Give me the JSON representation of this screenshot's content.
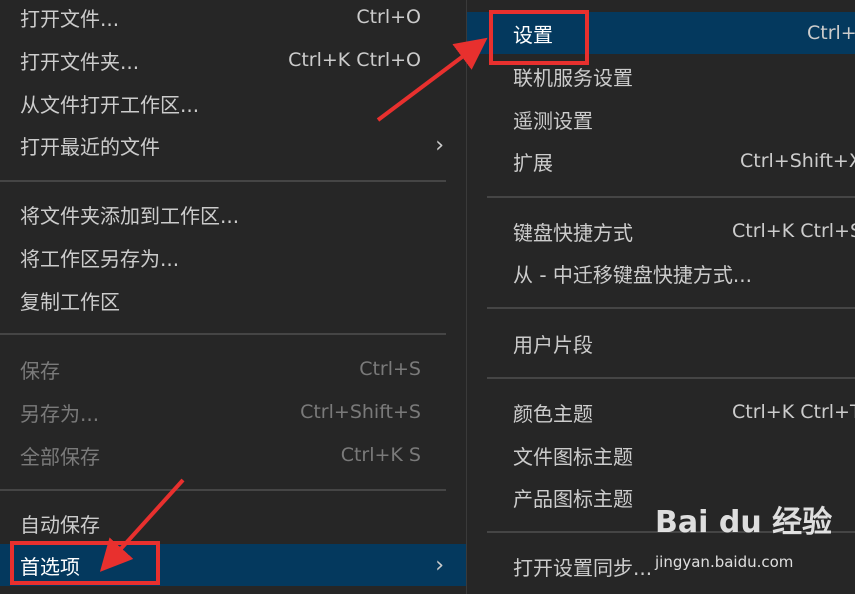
{
  "file_menu": {
    "items": [
      {
        "label": "打开文件...",
        "shortcut": "Ctrl+O"
      },
      {
        "label": "打开文件夹...",
        "shortcut": "Ctrl+K Ctrl+O"
      },
      {
        "label": "从文件打开工作区...",
        "shortcut": ""
      },
      {
        "label": "打开最近的文件",
        "shortcut": "",
        "submenu": true
      },
      {
        "label": "将文件夹添加到工作区...",
        "shortcut": ""
      },
      {
        "label": "将工作区另存为...",
        "shortcut": ""
      },
      {
        "label": "复制工作区",
        "shortcut": ""
      },
      {
        "label": "保存",
        "shortcut": "Ctrl+S",
        "disabled": true
      },
      {
        "label": "另存为...",
        "shortcut": "Ctrl+Shift+S",
        "disabled": true
      },
      {
        "label": "全部保存",
        "shortcut": "Ctrl+K S",
        "disabled": true
      },
      {
        "label": "自动保存",
        "shortcut": ""
      },
      {
        "label": "首选项",
        "shortcut": "",
        "submenu": true,
        "active": true
      }
    ],
    "chevron": "›"
  },
  "preferences_menu": {
    "items": [
      {
        "label": "设置",
        "shortcut": "Ctrl+",
        "active": true
      },
      {
        "label": "联机服务设置",
        "shortcut": ""
      },
      {
        "label": "遥测设置",
        "shortcut": ""
      },
      {
        "label": "扩展",
        "shortcut": "Ctrl+Shift+X"
      },
      {
        "label": "键盘快捷方式",
        "shortcut": "Ctrl+K Ctrl+S"
      },
      {
        "label": "从 - 中迁移键盘快捷方式...",
        "shortcut": ""
      },
      {
        "label": "用户片段",
        "shortcut": ""
      },
      {
        "label": "颜色主题",
        "shortcut": "Ctrl+K Ctrl+T"
      },
      {
        "label": "文件图标主题",
        "shortcut": ""
      },
      {
        "label": "产品图标主题",
        "shortcut": ""
      },
      {
        "label": "打开设置同步...",
        "shortcut": ""
      }
    ]
  },
  "annotations": {
    "box_color": "#e8302e",
    "arrow_color": "#e8302e"
  },
  "watermark": {
    "brand": "Bai du 经验",
    "domain": "jingyan.baidu.com"
  },
  "colors": {
    "menu_bg": "#262626",
    "active_bg": "#04395e",
    "text": "#cccccc",
    "disabled_text": "#7a7a7a",
    "separator": "#454545"
  }
}
